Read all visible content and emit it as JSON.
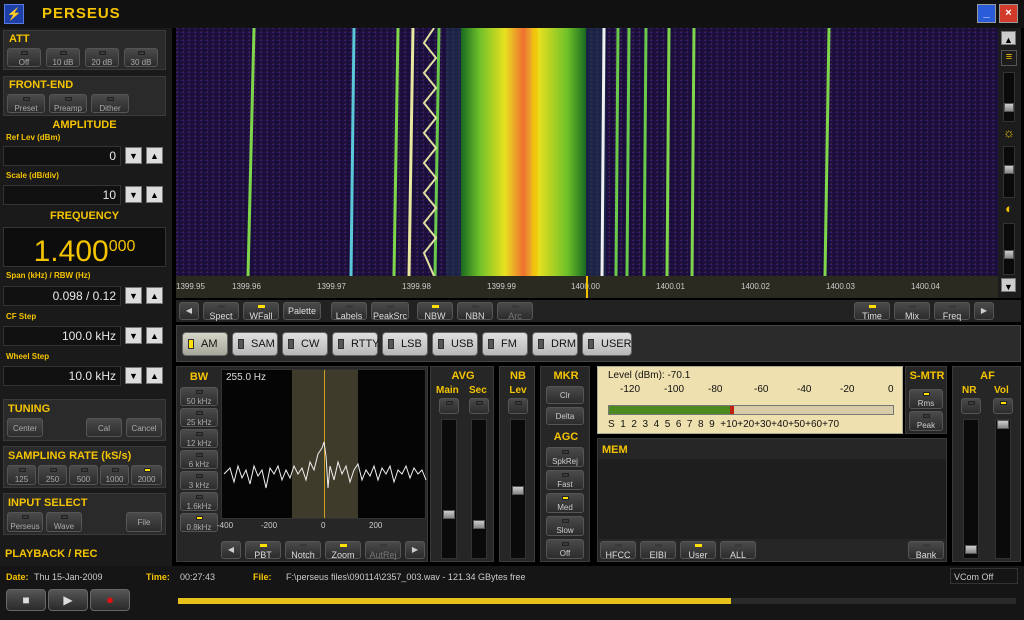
{
  "app": {
    "title": "PERSEUS"
  },
  "window": {
    "min": "_",
    "close": "×"
  },
  "att": {
    "title": "ATT",
    "buttons": [
      {
        "label": "Off",
        "on": false
      },
      {
        "label": "10 dB",
        "on": false
      },
      {
        "label": "20 dB",
        "on": false
      },
      {
        "label": "30 dB",
        "on": false
      }
    ]
  },
  "frontend": {
    "title": "FRONT-END",
    "buttons": [
      {
        "label": "Preset",
        "on": false
      },
      {
        "label": "Preamp",
        "on": false
      },
      {
        "label": "Dither",
        "on": false
      }
    ]
  },
  "amplitude": {
    "title": "AMPLITUDE",
    "ref_label": "Ref Lev (dBm)",
    "ref_value": "0",
    "scale_label": "Scale (dB/div)",
    "scale_value": "10"
  },
  "frequency": {
    "title": "FREQUENCY",
    "main": "1.400",
    "sub": "000",
    "span_label": "Span (kHz) / RBW (Hz)",
    "span_value": "0.098 / 0.12",
    "cf_label": "CF Step",
    "cf_value": "100.0 kHz",
    "wheel_label": "Wheel Step",
    "wheel_value": "10.0 kHz"
  },
  "tuning": {
    "title": "TUNING",
    "buttons": [
      {
        "label": "Center"
      },
      {
        "label": "Cal"
      },
      {
        "label": "Cancel"
      }
    ]
  },
  "sampling": {
    "title": "SAMPLING RATE (kS/s)",
    "buttons": [
      {
        "label": "125",
        "on": false
      },
      {
        "label": "250",
        "on": false
      },
      {
        "label": "500",
        "on": false
      },
      {
        "label": "1000",
        "on": false
      },
      {
        "label": "2000",
        "on": true
      }
    ]
  },
  "input": {
    "title": "INPUT SELECT",
    "buttons": [
      {
        "label": "Perseus",
        "on": false
      },
      {
        "label": "Wave",
        "on": false
      },
      {
        "label": "File",
        "on": false
      }
    ]
  },
  "playback": {
    "title": "PLAYBACK / REC"
  },
  "freq_axis": {
    "ticks": [
      "1399.95",
      "1399.96",
      "1399.97",
      "1399.98",
      "1399.99",
      "1400.00",
      "1400.01",
      "1400.02",
      "1400.03",
      "1400.04"
    ]
  },
  "toolbar": {
    "left": [
      {
        "label": "Spect",
        "on": false
      },
      {
        "label": "WFall",
        "on": true
      },
      {
        "label": "Palette",
        "on": false
      },
      {
        "label": "Labels",
        "on": false
      },
      {
        "label": "PeakSrc",
        "on": false
      },
      {
        "label": "NBW",
        "on": true
      },
      {
        "label": "NBN",
        "on": false
      },
      {
        "label": "Arc",
        "on": false
      }
    ],
    "right": [
      {
        "label": "Time",
        "on": true
      },
      {
        "label": "Mix",
        "on": false
      },
      {
        "label": "Freq",
        "on": false
      }
    ]
  },
  "modes": [
    {
      "label": "AM",
      "on": true
    },
    {
      "label": "SAM",
      "on": false
    },
    {
      "label": "CW",
      "on": false
    },
    {
      "label": "RTTY",
      "on": false
    },
    {
      "label": "LSB",
      "on": false
    },
    {
      "label": "USB",
      "on": false
    },
    {
      "label": "FM",
      "on": false
    },
    {
      "label": "DRM",
      "on": false
    },
    {
      "label": "USER",
      "on": false
    }
  ],
  "bw": {
    "title": "BW",
    "buttons": [
      {
        "label": "50 kHz"
      },
      {
        "label": "25 kHz"
      },
      {
        "label": "12 kHz"
      },
      {
        "label": "6 kHz"
      },
      {
        "label": "3 kHz"
      },
      {
        "label": "1.6kHz"
      },
      {
        "label": "0.8kHz"
      }
    ],
    "display_value": "255.0 Hz",
    "axis": [
      "-400",
      "-200",
      "0",
      "200"
    ],
    "bottom": [
      {
        "label": "PBT",
        "on": true
      },
      {
        "label": "Notch",
        "on": false
      },
      {
        "label": "Zoom",
        "on": true
      },
      {
        "label": "AutRej",
        "on": false
      }
    ]
  },
  "avg": {
    "title": "AVG",
    "main": "Main",
    "sec": "Sec"
  },
  "nb": {
    "title": "NB",
    "lev": "Lev"
  },
  "mkr": {
    "title": "MKR",
    "buttons": [
      {
        "label": "Clr"
      },
      {
        "label": "Delta"
      }
    ]
  },
  "agc": {
    "title": "AGC",
    "buttons": [
      {
        "label": "SpkRej",
        "on": false
      },
      {
        "label": "Fast",
        "on": false
      },
      {
        "label": "Med",
        "on": true
      },
      {
        "label": "Slow",
        "on": false
      },
      {
        "label": "Off",
        "on": false
      }
    ]
  },
  "level": {
    "text": "Level (dBm): -70.1",
    "dbm_scale": [
      "-120",
      "-100",
      "-80",
      "-60",
      "-40",
      "-20",
      "0"
    ],
    "s_scale": "S  1  2  3  4  5  6  7  8  9  +10+20+30+40+50+60+70",
    "fill_fraction": 0.44
  },
  "smtr": {
    "title": "S-MTR",
    "buttons": [
      {
        "label": "Rms",
        "on": true
      },
      {
        "label": "Peak",
        "on": false
      }
    ]
  },
  "af": {
    "title": "AF",
    "nr": "NR",
    "vol": "Vol"
  },
  "mem": {
    "title": "MEM",
    "buttons": [
      {
        "label": "HFCC",
        "on": false
      },
      {
        "label": "EIBI",
        "on": false
      },
      {
        "label": "User",
        "on": true
      },
      {
        "label": "ALL",
        "on": false
      },
      {
        "label": "Bank",
        "on": false
      }
    ]
  },
  "status": {
    "date_label": "Date:",
    "date": "Thu 15-Jan-2009",
    "time_label": "Time:",
    "time": "00:27:43",
    "file_label": "File:",
    "file": "F:\\perseus files\\090114\\2357_003.wav - 121.34 GBytes free",
    "vcom": "VCom Off",
    "progress": 0.66
  }
}
